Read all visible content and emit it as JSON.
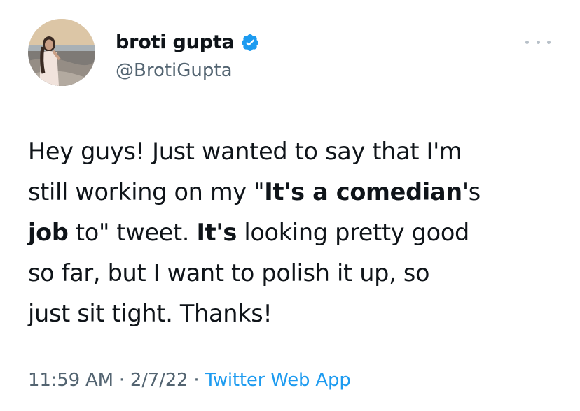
{
  "author": {
    "display_name": "broti gupta",
    "handle": "@BrotiGupta",
    "verified": true
  },
  "tweet": {
    "lines": [
      [
        {
          "text": "Hey guys! Just wanted to say that I'm",
          "bold": false
        }
      ],
      [
        {
          "text": "still working on my \"",
          "bold": false
        },
        {
          "text": "It's a comedian",
          "bold": true
        },
        {
          "text": "'s",
          "bold": false
        }
      ],
      [
        {
          "text": "job",
          "bold": true
        },
        {
          "text": " to\" tweet. ",
          "bold": false
        },
        {
          "text": "It's",
          "bold": true
        },
        {
          "text": " looking pretty good",
          "bold": false
        }
      ],
      [
        {
          "text": "so far, but I want to polish it up, so",
          "bold": false
        }
      ],
      [
        {
          "text": "just sit tight. Thanks!",
          "bold": false
        }
      ]
    ]
  },
  "meta": {
    "time": "11:59 AM",
    "separator": "·",
    "date": "2/7/22",
    "source": "Twitter Web App"
  },
  "colors": {
    "text": "#0f1419",
    "secondary": "#536471",
    "link": "#1d9bf0",
    "verified_badge": "#1d9bf0",
    "more_dots": "#b7c0c8"
  },
  "icons": {
    "verified": "verified-badge-icon",
    "more": "more-options-icon"
  }
}
